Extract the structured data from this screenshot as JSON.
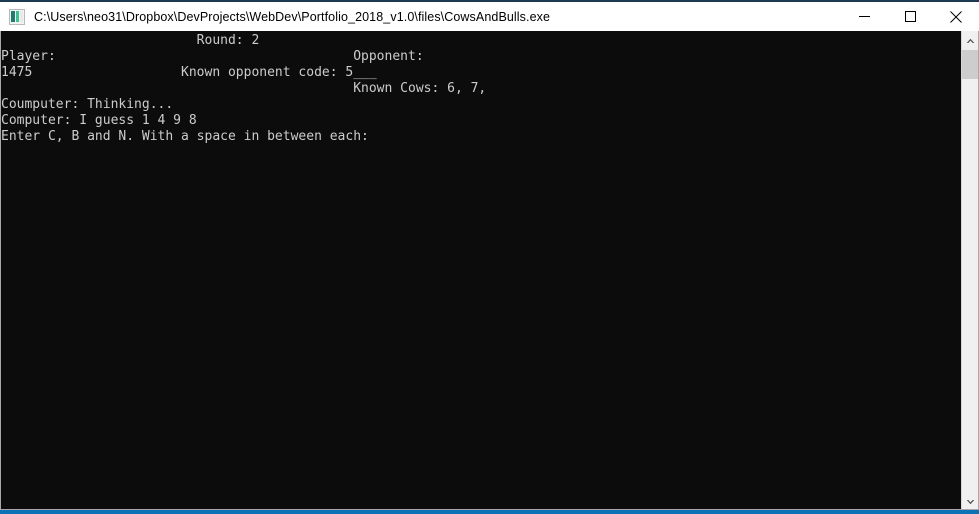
{
  "window": {
    "title": "C:\\Users\\neo31\\Dropbox\\DevProjects\\WebDev\\Portfolio_2018_v1.0\\files\\CowsAndBulls.exe",
    "icon": "console-app-icon",
    "controls": {
      "minimize_label": "Minimize",
      "maximize_label": "Maximize",
      "close_label": "Close"
    },
    "colors": {
      "titlebar_bg": "#ffffff",
      "console_bg": "#0c0c0c",
      "console_fg": "#cccccc",
      "accent_top": "#1d3a52",
      "accent_bottom": "#0b72b5",
      "scrollbar_track": "#f0f0f0",
      "scrollbar_thumb": "#cdcdcd"
    }
  },
  "console": {
    "lines": [
      "                         Round: 2",
      "Player:                                      Opponent:",
      "1475                   Known opponent code: 5___",
      "                                             Known Cows: 6, 7,",
      "Coumputer: Thinking...",
      "Computer: I guess 1 4 9 8",
      "Enter C, B and N. With a space in between each:"
    ],
    "text": "                         Round: 2\nPlayer:                                      Opponent:\n1475                   Known opponent code: 5___\n                                             Known Cows: 6, 7,\nCoumputer: Thinking...\nComputer: I guess 1 4 9 8\nEnter C, B and N. With a space in between each:",
    "fields": {
      "round_label": "Round:",
      "round_value": "2",
      "player_label": "Player:",
      "player_value": "1475",
      "opponent_label": "Opponent:",
      "known_opponent_code_label": "Known opponent code:",
      "known_opponent_code_value": "5___",
      "known_cows_label": "Known Cows:",
      "known_cows_value": "6, 7,",
      "thinking_line": "Coumputer: Thinking...",
      "guess_line": "Computer: I guess 1 4 9 8",
      "prompt_line": "Enter C, B and N. With a space in between each:"
    }
  },
  "scrollbar": {
    "up_arrow": "chevron-up-icon",
    "down_arrow": "chevron-down-icon",
    "thumb": "scrollbar-thumb"
  }
}
